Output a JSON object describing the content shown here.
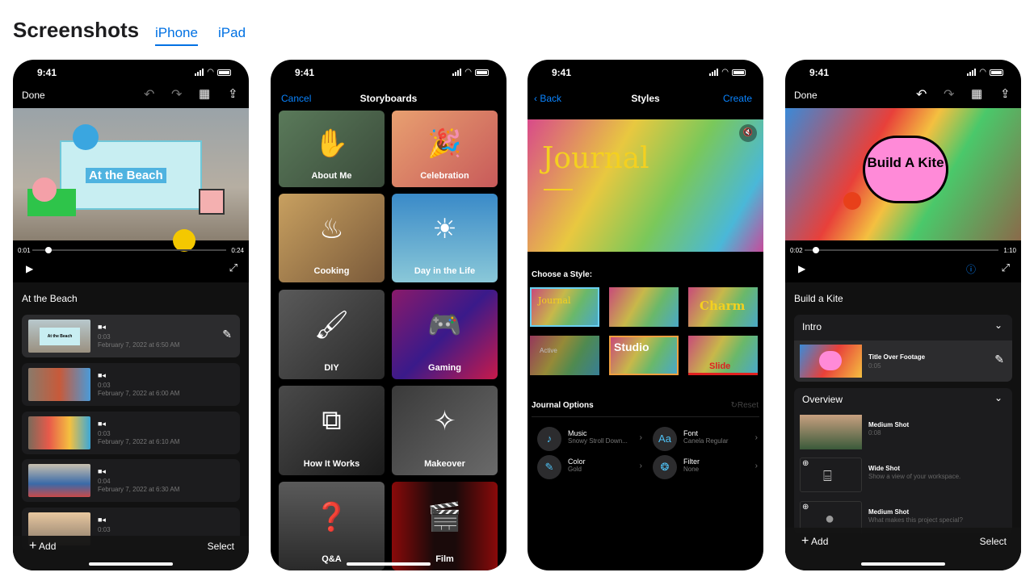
{
  "header": {
    "title": "Screenshots",
    "tabs": [
      {
        "label": "iPhone",
        "active": true
      },
      {
        "label": "iPad",
        "active": false
      }
    ]
  },
  "accent": "#0071e3",
  "time": "9:41",
  "phone1": {
    "done": "Done",
    "overlay_title": "At the Beach",
    "current": "0:01",
    "total": "0:24",
    "project": "At the Beach",
    "clips": [
      {
        "duration": "0:03",
        "date": "February 7, 2022 at 6:50 AM",
        "thumb_text": "At the Beach"
      },
      {
        "duration": "0:03",
        "date": "February 7, 2022 at 6:00 AM"
      },
      {
        "duration": "0:03",
        "date": "February 7, 2022 at 6:10 AM"
      },
      {
        "duration": "0:04",
        "date": "February 7, 2022 at 6:30 AM"
      },
      {
        "duration": "0:03"
      }
    ],
    "add": "Add",
    "select": "Select"
  },
  "phone2": {
    "cancel": "Cancel",
    "title": "Storyboards",
    "tiles": [
      {
        "label": "About Me",
        "icon": "wave-hand-icon"
      },
      {
        "label": "Celebration",
        "icon": "party-popper-icon"
      },
      {
        "label": "Cooking",
        "icon": "pot-icon"
      },
      {
        "label": "Day in the Life",
        "icon": "sunrise-icon"
      },
      {
        "label": "DIY",
        "icon": "paint-roller-icon"
      },
      {
        "label": "Gaming",
        "icon": "gamecontroller-icon"
      },
      {
        "label": "How It Works",
        "icon": "flowchart-icon"
      },
      {
        "label": "Makeover",
        "icon": "sparkle-icon"
      },
      {
        "label": "Q&A",
        "icon": "question-bubble-icon"
      },
      {
        "label": "Film",
        "icon": "director-chair-icon"
      }
    ]
  },
  "phone3": {
    "back": "Back",
    "title": "Styles",
    "create": "Create",
    "hero_text": "Journal",
    "choose": "Choose a Style:",
    "styles": [
      {
        "label": "Journal",
        "selected": true
      },
      {
        "label": ""
      },
      {
        "label": "Charm"
      },
      {
        "label": "Active"
      },
      {
        "label": "Studio"
      },
      {
        "label": "Slide"
      }
    ],
    "options_title": "Journal Options",
    "reset": "Reset",
    "options": [
      {
        "name": "Music",
        "value": "Snowy Stroll Down...",
        "icon": "♪"
      },
      {
        "name": "Font",
        "value": "Canela Regular",
        "icon": "Aa"
      },
      {
        "name": "Color",
        "value": "Gold",
        "icon": "✎"
      },
      {
        "name": "Filter",
        "value": "None",
        "icon": "❂"
      }
    ]
  },
  "phone4": {
    "done": "Done",
    "overlay_title": "Build A Kite",
    "current": "0:02",
    "total": "1:10",
    "project": "Build a Kite",
    "sections": [
      {
        "title": "Intro",
        "items": [
          {
            "name": "Title Over Footage",
            "detail": "0:05"
          }
        ]
      },
      {
        "title": "Overview",
        "items": [
          {
            "name": "Medium Shot",
            "detail": "0:08"
          },
          {
            "name": "Wide Shot",
            "detail": "Show a view of your workspace."
          },
          {
            "name": "Medium Shot",
            "detail": "What makes this project special?"
          }
        ]
      }
    ],
    "add": "Add",
    "select": "Select"
  }
}
